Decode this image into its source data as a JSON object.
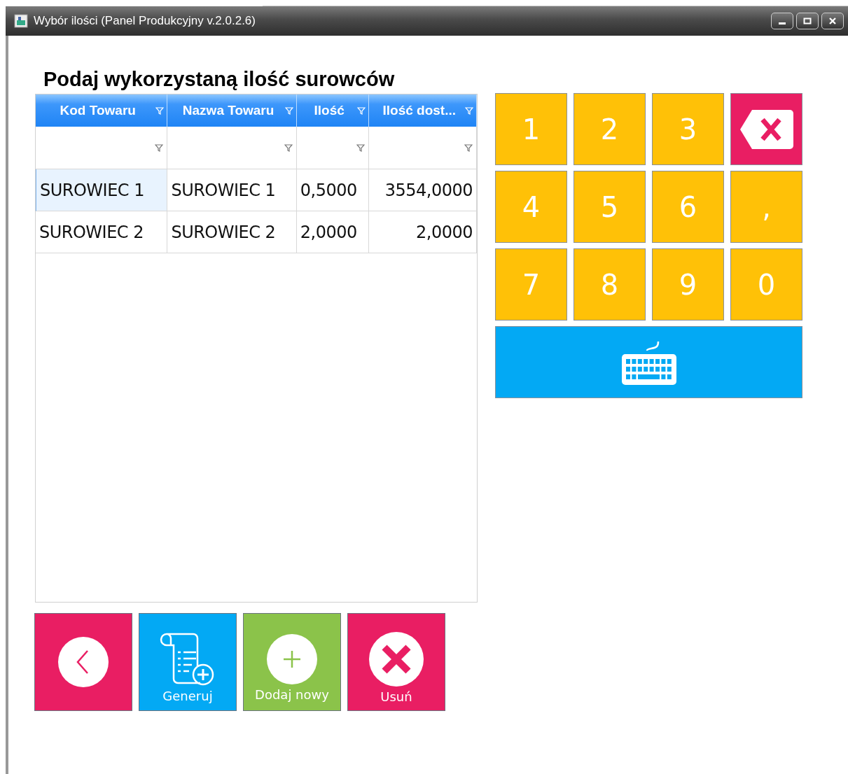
{
  "window": {
    "title": "Wybór ilości (Panel Produkcyjny v.2.0.2.6)"
  },
  "heading": "Podaj wykorzystaną ilość surowców",
  "table": {
    "columns": [
      {
        "label": "Kod Towaru"
      },
      {
        "label": "Nazwa Towaru"
      },
      {
        "label": "Ilość"
      },
      {
        "label": "Ilość dost..."
      }
    ],
    "rows": [
      {
        "selected": true,
        "cells": [
          "SUROWIEC 1",
          "SUROWIEC 1",
          "0,5000",
          "3554,0000"
        ]
      },
      {
        "selected": false,
        "cells": [
          "SUROWIEC 2",
          "SUROWIEC 2",
          "2,0000",
          "2,0000"
        ]
      }
    ]
  },
  "keypad": {
    "keys": [
      {
        "kind": "digit",
        "label": "1"
      },
      {
        "kind": "digit",
        "label": "2"
      },
      {
        "kind": "digit",
        "label": "3"
      },
      {
        "kind": "backspace"
      },
      {
        "kind": "digit",
        "label": "4"
      },
      {
        "kind": "digit",
        "label": "5"
      },
      {
        "kind": "digit",
        "label": "6"
      },
      {
        "kind": "digit",
        "label": ","
      },
      {
        "kind": "digit",
        "label": "7"
      },
      {
        "kind": "digit",
        "label": "8"
      },
      {
        "kind": "digit",
        "label": "9"
      },
      {
        "kind": "digit",
        "label": "0"
      },
      {
        "kind": "keyboard"
      }
    ]
  },
  "actions": [
    {
      "kind": "back",
      "color": "#e91e63"
    },
    {
      "kind": "generate",
      "label": "Generuj",
      "color": "#03a9f4"
    },
    {
      "kind": "add",
      "label": "Dodaj nowy",
      "color": "#8bc34a"
    },
    {
      "kind": "delete",
      "label": "Usuń",
      "color": "#e91e63"
    }
  ]
}
